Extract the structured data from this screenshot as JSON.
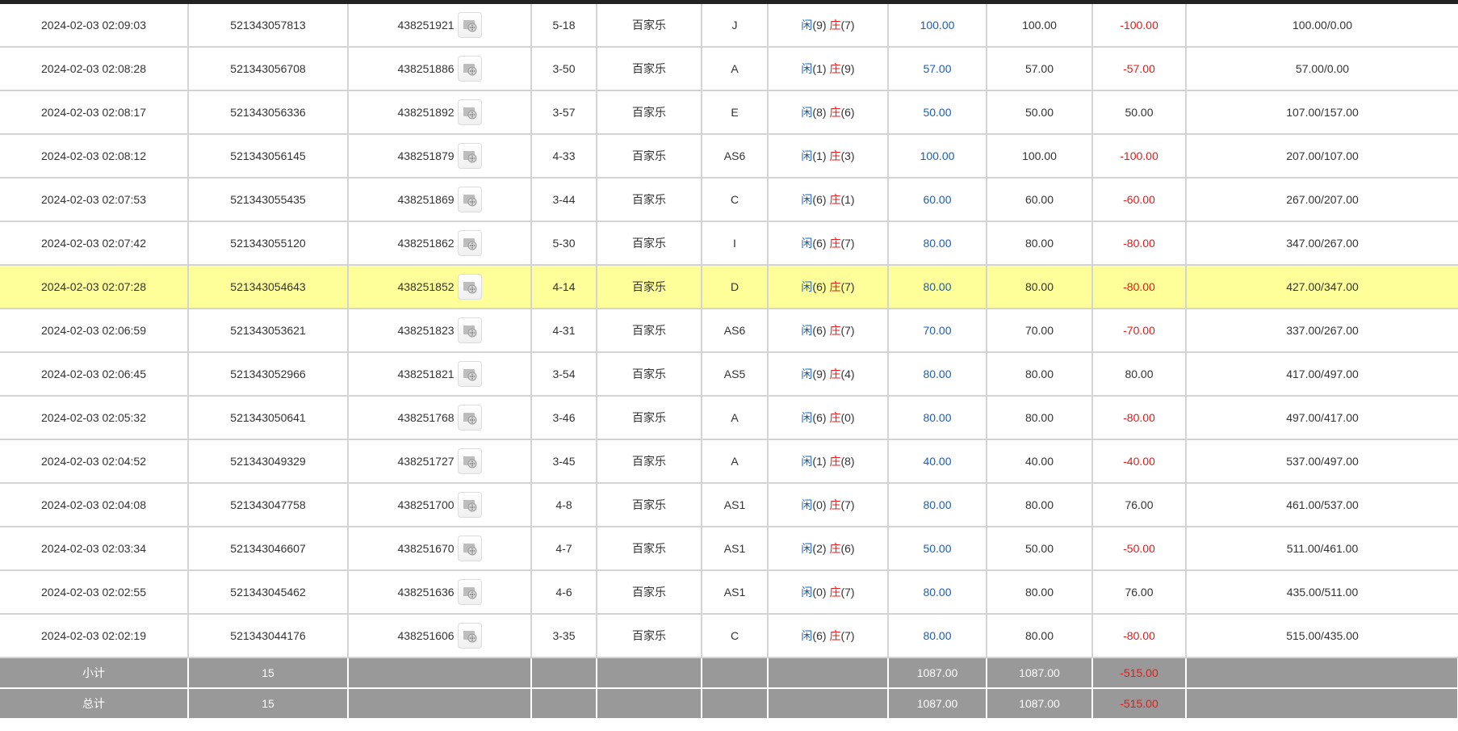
{
  "rows": [
    {
      "time": "2024-02-03 02:09:03",
      "order": "521343057813",
      "game": "438251921",
      "shoe": "5-18",
      "type": "百家乐",
      "table": "J",
      "player_label": "闲",
      "player_score": "(9)",
      "banker_label": "庄",
      "banker_score": "(7)",
      "bet": "100.00",
      "valid": "100.00",
      "win": "-100.00",
      "win_negative": true,
      "balance": "100.00/0.00"
    },
    {
      "time": "2024-02-03 02:08:28",
      "order": "521343056708",
      "game": "438251886",
      "shoe": "3-50",
      "type": "百家乐",
      "table": "A",
      "player_label": "闲",
      "player_score": "(1)",
      "banker_label": "庄",
      "banker_score": "(9)",
      "bet": "57.00",
      "valid": "57.00",
      "win": "-57.00",
      "win_negative": true,
      "balance": "57.00/0.00"
    },
    {
      "time": "2024-02-03 02:08:17",
      "order": "521343056336",
      "game": "438251892",
      "shoe": "3-57",
      "type": "百家乐",
      "table": "E",
      "player_label": "闲",
      "player_score": "(8)",
      "banker_label": "庄",
      "banker_score": "(6)",
      "bet": "50.00",
      "valid": "50.00",
      "win": "50.00",
      "win_negative": false,
      "balance": "107.00/157.00"
    },
    {
      "time": "2024-02-03 02:08:12",
      "order": "521343056145",
      "game": "438251879",
      "shoe": "4-33",
      "type": "百家乐",
      "table": "AS6",
      "player_label": "闲",
      "player_score": "(1)",
      "banker_label": "庄",
      "banker_score": "(3)",
      "bet": "100.00",
      "valid": "100.00",
      "win": "-100.00",
      "win_negative": true,
      "balance": "207.00/107.00"
    },
    {
      "time": "2024-02-03 02:07:53",
      "order": "521343055435",
      "game": "438251869",
      "shoe": "3-44",
      "type": "百家乐",
      "table": "C",
      "player_label": "闲",
      "player_score": "(6)",
      "banker_label": "庄",
      "banker_score": "(1)",
      "bet": "60.00",
      "valid": "60.00",
      "win": "-60.00",
      "win_negative": true,
      "balance": "267.00/207.00"
    },
    {
      "time": "2024-02-03 02:07:42",
      "order": "521343055120",
      "game": "438251862",
      "shoe": "5-30",
      "type": "百家乐",
      "table": "I",
      "player_label": "闲",
      "player_score": "(6)",
      "banker_label": "庄",
      "banker_score": "(7)",
      "bet": "80.00",
      "valid": "80.00",
      "win": "-80.00",
      "win_negative": true,
      "balance": "347.00/267.00"
    },
    {
      "time": "2024-02-03 02:07:28",
      "order": "521343054643",
      "game": "438251852",
      "shoe": "4-14",
      "type": "百家乐",
      "table": "D",
      "player_label": "闲",
      "player_score": "(6)",
      "banker_label": "庄",
      "banker_score": "(7)",
      "bet": "80.00",
      "valid": "80.00",
      "win": "-80.00",
      "win_negative": true,
      "balance": "427.00/347.00",
      "highlight": true
    },
    {
      "time": "2024-02-03 02:06:59",
      "order": "521343053621",
      "game": "438251823",
      "shoe": "4-31",
      "type": "百家乐",
      "table": "AS6",
      "player_label": "闲",
      "player_score": "(6)",
      "banker_label": "庄",
      "banker_score": "(7)",
      "bet": "70.00",
      "valid": "70.00",
      "win": "-70.00",
      "win_negative": true,
      "balance": "337.00/267.00"
    },
    {
      "time": "2024-02-03 02:06:45",
      "order": "521343052966",
      "game": "438251821",
      "shoe": "3-54",
      "type": "百家乐",
      "table": "AS5",
      "player_label": "闲",
      "player_score": "(9)",
      "banker_label": "庄",
      "banker_score": "(4)",
      "bet": "80.00",
      "valid": "80.00",
      "win": "80.00",
      "win_negative": false,
      "balance": "417.00/497.00"
    },
    {
      "time": "2024-02-03 02:05:32",
      "order": "521343050641",
      "game": "438251768",
      "shoe": "3-46",
      "type": "百家乐",
      "table": "A",
      "player_label": "闲",
      "player_score": "(6)",
      "banker_label": "庄",
      "banker_score": "(0)",
      "bet": "80.00",
      "valid": "80.00",
      "win": "-80.00",
      "win_negative": true,
      "balance": "497.00/417.00"
    },
    {
      "time": "2024-02-03 02:04:52",
      "order": "521343049329",
      "game": "438251727",
      "shoe": "3-45",
      "type": "百家乐",
      "table": "A",
      "player_label": "闲",
      "player_score": "(1)",
      "banker_label": "庄",
      "banker_score": "(8)",
      "bet": "40.00",
      "valid": "40.00",
      "win": "-40.00",
      "win_negative": true,
      "balance": "537.00/497.00"
    },
    {
      "time": "2024-02-03 02:04:08",
      "order": "521343047758",
      "game": "438251700",
      "shoe": "4-8",
      "type": "百家乐",
      "table": "AS1",
      "player_label": "闲",
      "player_score": "(0)",
      "banker_label": "庄",
      "banker_score": "(7)",
      "bet": "80.00",
      "valid": "80.00",
      "win": "76.00",
      "win_negative": false,
      "balance": "461.00/537.00"
    },
    {
      "time": "2024-02-03 02:03:34",
      "order": "521343046607",
      "game": "438251670",
      "shoe": "4-7",
      "type": "百家乐",
      "table": "AS1",
      "player_label": "闲",
      "player_score": "(2)",
      "banker_label": "庄",
      "banker_score": "(6)",
      "bet": "50.00",
      "valid": "50.00",
      "win": "-50.00",
      "win_negative": true,
      "balance": "511.00/461.00"
    },
    {
      "time": "2024-02-03 02:02:55",
      "order": "521343045462",
      "game": "438251636",
      "shoe": "4-6",
      "type": "百家乐",
      "table": "AS1",
      "player_label": "闲",
      "player_score": "(0)",
      "banker_label": "庄",
      "banker_score": "(7)",
      "bet": "80.00",
      "valid": "80.00",
      "win": "76.00",
      "win_negative": false,
      "balance": "435.00/511.00"
    },
    {
      "time": "2024-02-03 02:02:19",
      "order": "521343044176",
      "game": "438251606",
      "shoe": "3-35",
      "type": "百家乐",
      "table": "C",
      "player_label": "闲",
      "player_score": "(6)",
      "banker_label": "庄",
      "banker_score": "(7)",
      "bet": "80.00",
      "valid": "80.00",
      "win": "-80.00",
      "win_negative": true,
      "balance": "515.00/435.00"
    }
  ],
  "subtotal": {
    "label": "小计",
    "count": "15",
    "bet": "1087.00",
    "valid": "1087.00",
    "win": "-515.00"
  },
  "total": {
    "label": "总计",
    "count": "15",
    "bet": "1087.00",
    "valid": "1087.00",
    "win": "-515.00"
  },
  "icons": {
    "replay": "film-reel-icon"
  },
  "colors": {
    "highlight": "#ffff99",
    "positive_blue": "#1a5fb4",
    "negative_red": "#e01b1b",
    "summary_bg": "#999999"
  }
}
